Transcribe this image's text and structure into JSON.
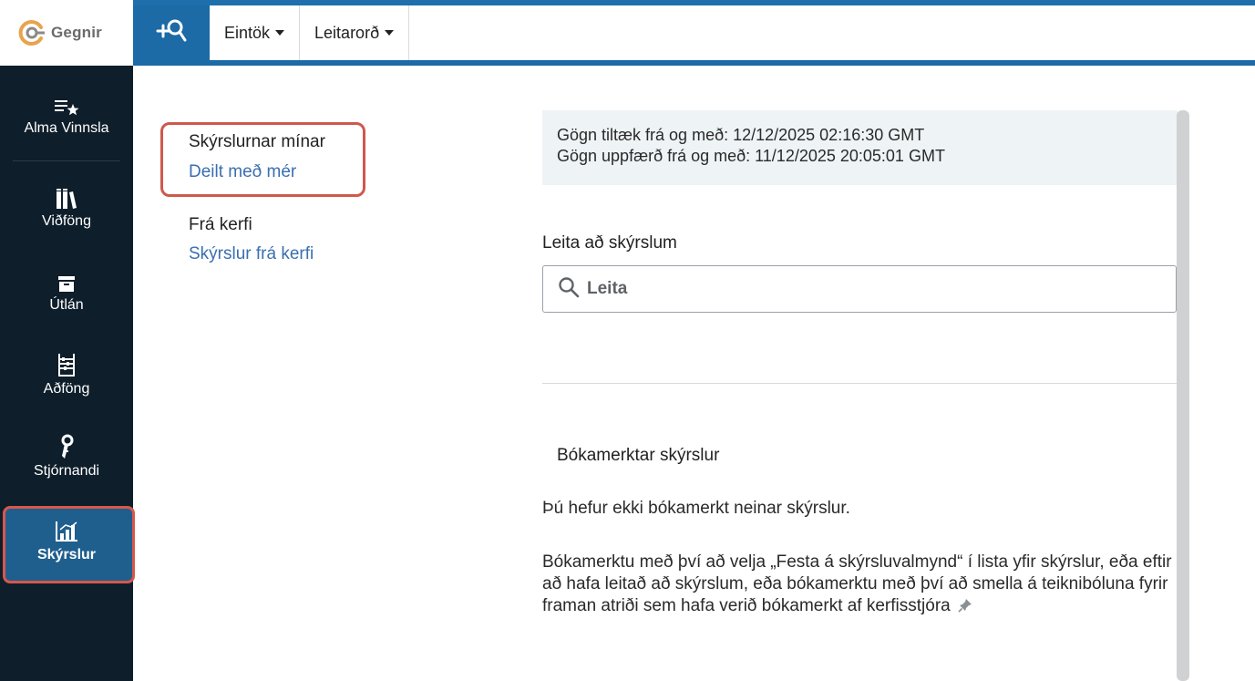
{
  "brand": {
    "name": "Gegnir",
    "accent": "#1c6aa6",
    "logo_orange": "#e8a34c"
  },
  "toolbar": {
    "search_toggle_icon": "search-plus-icon",
    "dropdowns": [
      {
        "label": "Eintök"
      },
      {
        "label": "Leitarorð"
      }
    ]
  },
  "sidebar": {
    "items": [
      {
        "label": "Alma Vinnsla",
        "icon": "list-star-icon"
      },
      {
        "label": "Viðföng",
        "icon": "books-icon"
      },
      {
        "label": "Útlán",
        "icon": "archive-box-icon"
      },
      {
        "label": "Aðföng",
        "icon": "abacus-icon"
      },
      {
        "label": "Stjórnandi",
        "icon": "key-icon"
      },
      {
        "label": "Skýrslur",
        "icon": "bar-chart-icon",
        "active": true
      }
    ]
  },
  "leftnav": {
    "group1": {
      "heading": "Skýrslurnar mínar",
      "link": "Deilt með mér"
    },
    "group2": {
      "heading": "Frá kerfi",
      "link": "Skýrslur frá kerfi"
    }
  },
  "main": {
    "info_line1": "Gögn tiltæk frá og með: 12/12/2025 02:16:30 GMT",
    "info_line2": "Gögn uppfærð frá og með: 11/12/2025 20:05:01 GMT",
    "search_label": "Leita að skýrslum",
    "search_placeholder": "Leita",
    "bookmarked_title": "Bókamerktar skýrslur",
    "bookmarked_empty": "Þú hefur ekki bókamerkt neinar skýrslur.",
    "bookmarked_help": "Bókamerktu með því að velja „Festa á skýrsluvalmynd“ í lista yfir skýrslur, eða eftir að hafa leitað að skýrslum, eða bókamerktu með því að smella á teiknibóluna fyrir framan atriði sem hafa verið bókamerkt af kerfisstjóra"
  }
}
